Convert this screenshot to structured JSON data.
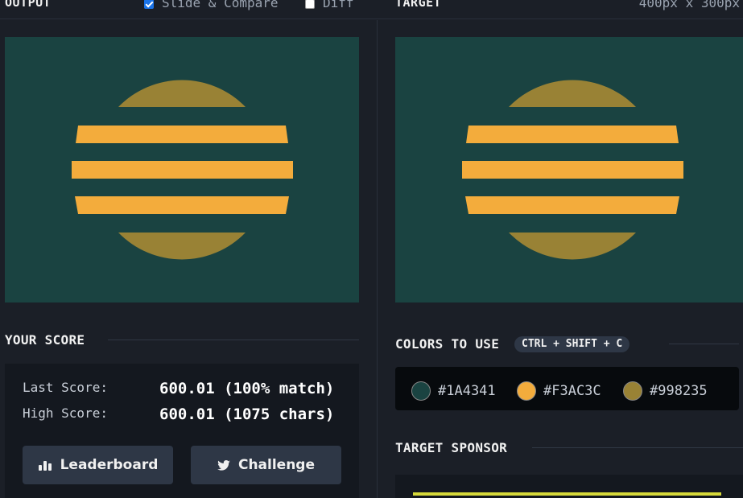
{
  "header": {
    "output_title": "OUTPUT",
    "slide_compare_label": "Slide & Compare",
    "slide_compare_checked": true,
    "diff_label": "Diff",
    "diff_checked": false,
    "target_title": "TARGET",
    "dimensions": "400px x 300px"
  },
  "score": {
    "title": "YOUR SCORE",
    "last_label": "Last Score:",
    "last_value": "600.01 (100% match)",
    "high_label": "High Score:",
    "high_value": "600.01 (1075 chars)",
    "leaderboard_label": "Leaderboard",
    "challenge_label": "Challenge"
  },
  "colors": {
    "title": "COLORS TO USE",
    "shortcut": "CTRL + SHIFT + C",
    "swatches": [
      {
        "hex": "#1A4341",
        "color": "#1a4341"
      },
      {
        "hex": "#F3AC3C",
        "color": "#f3ac3c"
      },
      {
        "hex": "#998235",
        "color": "#998235"
      }
    ]
  },
  "sponsor": {
    "title": "TARGET SPONSOR"
  }
}
